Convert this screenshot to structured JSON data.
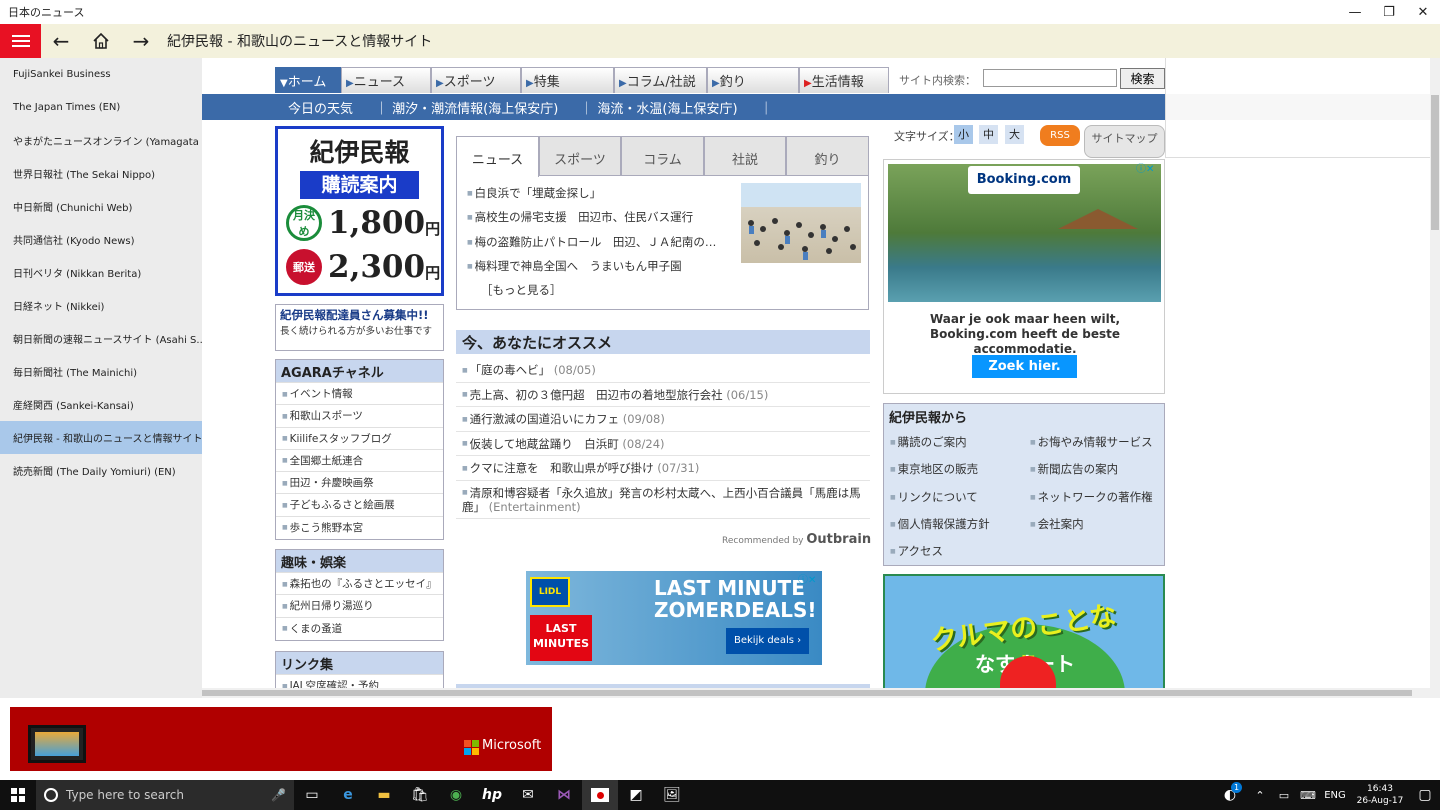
{
  "window": {
    "title": "日本のニュース"
  },
  "appbar": {
    "page_title": "紀伊民報 - 和歌山のニュースと情報サイト"
  },
  "sidebar": {
    "items": [
      "FujiSankei Business",
      "The Japan Times (EN)",
      "やまがたニュースオンライン (Yamagata S...)",
      "世界日報社 (The Sekai Nippo)",
      "中日新聞 (Chunichi Web)",
      "共同通信社 (Kyodo News)",
      "日刊ベリタ (Nikkan Berita)",
      "日経ネット (Nikkei)",
      "朝日新聞の速報ニュースサイト (Asahi S...)",
      "毎日新聞社 (The Mainichi)",
      "産経関西 (Sankei-Kansai)",
      "紀伊民報 - 和歌山のニュースと情報サイト",
      "読売新聞 (The Daily Yomiuri) (EN)"
    ],
    "selected_index": 11
  },
  "site": {
    "tabs": [
      "ホーム",
      "ニュース",
      "スポーツ",
      "特集",
      "コラム/社説",
      "釣り",
      "生活情報"
    ],
    "search_label": "サイト内検索：",
    "search_button": "検索",
    "subnav": [
      "今日の天気",
      "｜ 潮汐・潮流情報(海上保安庁)",
      "｜ 海流・水温(海上保安庁)",
      "｜"
    ],
    "promo": {
      "logo": "紀伊民報",
      "subtitle": "購読案内",
      "monthly_tag": "月決め",
      "monthly_price": "1,800",
      "mail_tag": "郵送",
      "mail_price": "2,300",
      "yen": "円"
    },
    "recruit": {
      "title": "紀伊民報配達員さん募集中!!",
      "text": "長く続けられる方が多いお仕事です"
    },
    "agara": {
      "title": "AGARAチャネル",
      "items": [
        "イベント情報",
        "和歌山スポーツ",
        "Kiilifeスタッフブログ",
        "全国郷土紙連合",
        "田辺・弁慶映画祭",
        "子どもふるさと絵画展",
        "歩こう熊野本宮"
      ]
    },
    "hobby": {
      "title": "趣味・娯楽",
      "items": [
        "森拓也の『ふるさとエッセイ』",
        "紀州日帰り湯巡り",
        "くまの蚤道"
      ]
    },
    "links": {
      "title": "リンク集",
      "items": [
        "JAL空席確認・予約"
      ]
    },
    "news_tabs": [
      "ニュース",
      "スポーツ",
      "コラム",
      "社説",
      "釣り"
    ],
    "news_items": [
      "白良浜で「埋蔵金探し」",
      "高校生の帰宅支援　田辺市、住民バス運行",
      "梅の盗難防止パトロール　田辺、ＪＡ紀南の…",
      "梅料理で神島全国へ　うまいもん甲子園"
    ],
    "news_more": "［もっと見る］",
    "recommend": {
      "title": "今、あなたにオススメ",
      "items": [
        {
          "text": "「庭の毒ヘビ」",
          "date": "(08/05)"
        },
        {
          "text": "売上高、初の３億円超　田辺市の着地型旅行会社",
          "date": "(06/15)"
        },
        {
          "text": "通行激減の国道沿いにカフェ",
          "date": "(09/08)"
        },
        {
          "text": "仮装して地蔵盆踊り　白浜町",
          "date": "(08/24)"
        },
        {
          "text": "クマに注意を　和歌山県が呼び掛け",
          "date": "(07/31)"
        },
        {
          "text": "清原和博容疑者「永久追放」発言の杉村太蔵へ、上西小百合議員「馬鹿は馬鹿」",
          "date": "(Entertainment)"
        }
      ],
      "by": "Recommended by",
      "brand": "Outbrain"
    },
    "lidl": {
      "brand": "LIDL",
      "line1": "LAST MINUTE",
      "line2": "ZOMERDEALS!",
      "badge1": "LAST",
      "badge2": "MINUTES",
      "cta": "Bekijk deals ›"
    },
    "fontsize": {
      "label": "文字サイズ：",
      "small": "小",
      "mid": "中",
      "large": "大"
    },
    "rss": "RSS",
    "sitemap": "サイトマップ",
    "booking": {
      "brand": "Booking.com",
      "text": "Waar je ook maar heen wilt, Booking.com heeft de beste accommodatie.",
      "cta": "Zoek hier."
    },
    "kii": {
      "title": "紀伊民報から",
      "left": [
        "購読のご案内",
        "東京地区の販売",
        "リンクについて",
        "個人情報保護方針",
        "アクセス"
      ],
      "right": [
        "お悔やみ情報サービス",
        "新聞広告の案内",
        "ネットワークの著作権",
        "会社案内"
      ]
    },
    "car_ad": {
      "text": "クルマのことなら",
      "sub": "なすオート"
    }
  },
  "ad_banner": {
    "brand": "Microsoft"
  },
  "taskbar": {
    "search_placeholder": "Type here to search",
    "lang": "ENG",
    "time": "16:43",
    "date": "26-Aug-17",
    "badge": "1"
  },
  "colors": {
    "accent_red": "#e81123",
    "site_blue": "#3b6aa8",
    "appbar_bg": "#f3f1dc",
    "sidebar_sel": "#a9c8ea"
  }
}
